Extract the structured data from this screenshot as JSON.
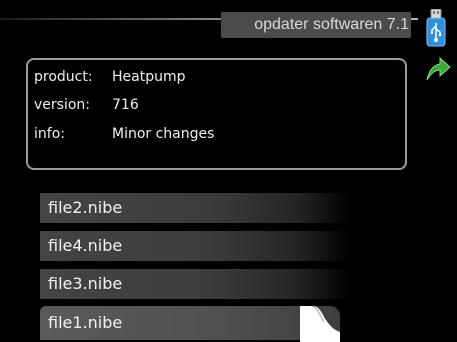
{
  "header": {
    "title": "opdater softwaren 7.1"
  },
  "icons": {
    "usb": "usb-stick-icon",
    "back": "back-arrow-icon"
  },
  "colors": {
    "panel_border": "#9a9a9a",
    "usb_blue": "#2f8fd8",
    "arrow_green": "#3fa53b",
    "title_bg": "#4b4b4b"
  },
  "info": {
    "rows": [
      {
        "label": "product:",
        "value": "Heatpump"
      },
      {
        "label": "version:",
        "value": "716"
      },
      {
        "label": "info:",
        "value": "Minor changes"
      }
    ]
  },
  "files": {
    "items": [
      {
        "label": "file2.nibe"
      },
      {
        "label": "file4.nibe"
      },
      {
        "label": "file3.nibe"
      },
      {
        "label": "file1.nibe"
      }
    ],
    "selected": "file1.nibe"
  }
}
